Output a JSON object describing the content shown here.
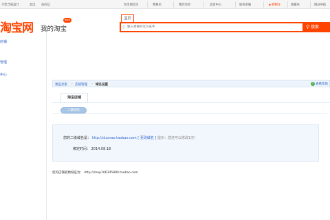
{
  "topbar": {
    "left": [
      "夕影浮虫設计",
      "退出",
      "站内信"
    ],
    "right": [
      "淘宝网首页",
      "我要买",
      "我的淘宝",
      "卖家中心",
      "联系客服",
      "购物车",
      "收藏夹",
      "网站导航"
    ]
  },
  "header": {
    "logo": "淘宝网",
    "subtitle": "我的淘宝",
    "badge": "beta",
    "search_tab": "宝贝",
    "search_placeholder": "输入想要的宝贝名字",
    "search_button": "搜索"
  },
  "leftnav": {
    "items": [
      "店铺",
      "管理",
      "中心"
    ]
  },
  "breadcrumb": {
    "items": [
      "我是卖家",
      "店铺管理",
      "域名设置"
    ],
    "help": "查看帮助"
  },
  "tabs": {
    "main": "淘宝店铺",
    "sub": "二级域名"
  },
  "domain": {
    "label": "您的二级域名是：",
    "url": "http://duonao.taobao.com",
    "change": "[ 更改域名 ]",
    "tip": "提示：您还可以修改1次！",
    "time_label": "绑定时间：",
    "time_value": "2014.08.18"
  },
  "default_domain": {
    "label": "您的店铺初始域名为：",
    "url": "http://shop106345880.taobao.com"
  },
  "colors": {
    "brand": "#ff4400",
    "link": "#3366cc",
    "panel": "#f2f7fd"
  }
}
